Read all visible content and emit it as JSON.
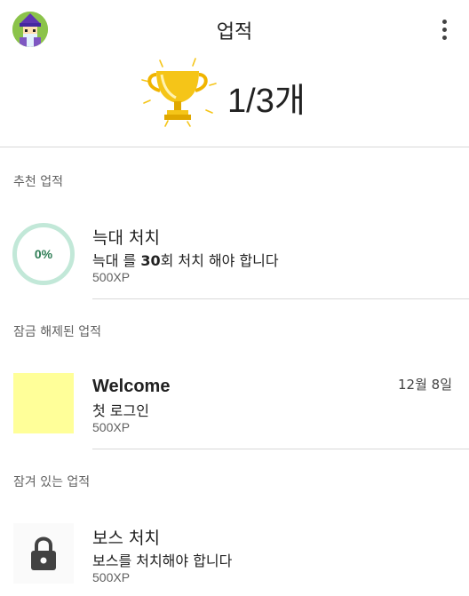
{
  "header": {
    "title": "업적",
    "progress": "1/3개",
    "avatar_icon": "wizard-avatar-icon",
    "more_icon": "more-vert-icon",
    "trophy_icon": "trophy-icon"
  },
  "sections": {
    "recommended": "추천 업적",
    "unlocked": "잠금 해제된 업적",
    "locked": "잠겨 있는 업적"
  },
  "recommended": {
    "percent": "0%",
    "progress_fraction": 0,
    "name": "늑대 처치",
    "desc_prefix": "늑대 를 ",
    "desc_count": "30",
    "desc_suffix": "회 처치 해야 합니다",
    "xp": "500XP"
  },
  "unlocked": {
    "name": "Welcome",
    "desc": "첫 로그인",
    "xp": "500XP",
    "date": "12월 8일",
    "thumb_color": "#ffff99"
  },
  "locked": {
    "name": "보스 처치",
    "desc": "보스를 처치해야 합니다",
    "xp": "500XP",
    "icon": "lock-icon"
  },
  "colors": {
    "ring": "#c2e8d8",
    "ring_text": "#2e7d55",
    "trophy": "#f5c518"
  }
}
